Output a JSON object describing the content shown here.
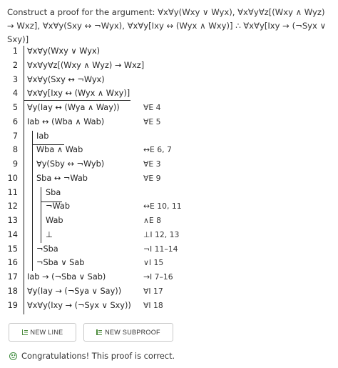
{
  "prompt": "Construct a proof for the argument: ∀x∀y(Wxy ∨ Wyx), ∀x∀y∀z[(Wxy ∧ Wyz) → Wxz], ∀x∀y(Sxy ↔ ¬Wyx), ∀x∀y[Ixy ↔ (Wyx ∧ Wxy)] ∴ ∀x∀y[Ixy → (¬Syx ∨ Sxy)]",
  "lines": [
    {
      "num": "1",
      "formula": "∀x∀y(Wxy ∨ Wyx)",
      "just": "",
      "depth": 0
    },
    {
      "num": "2",
      "formula": "∀x∀y∀z[(Wxy ∧ Wyz) → Wxz]",
      "just": "",
      "depth": 0
    },
    {
      "num": "3",
      "formula": "∀x∀y(Sxy ↔ ¬Wyx)",
      "just": "",
      "depth": 0
    },
    {
      "num": "4",
      "formula": "∀x∀y[Ixy ↔ (Wyx ∧ Wxy)]",
      "just": "",
      "depth": 0
    },
    {
      "num": "5",
      "formula": "∀y(Iay ↔ (Wya ∧ Way))",
      "just": "∀E 4",
      "depth": 0
    },
    {
      "num": "6",
      "formula": "Iab ↔ (Wba ∧ Wab)",
      "just": "∀E 5",
      "depth": 0
    },
    {
      "num": "7",
      "formula": "Iab",
      "just": "",
      "depth": 1
    },
    {
      "num": "8",
      "formula": "Wba ∧ Wab",
      "just": "↔E 6, 7",
      "depth": 1
    },
    {
      "num": "9",
      "formula": "∀y(Sby ↔ ¬Wyb)",
      "just": "∀E 3",
      "depth": 1
    },
    {
      "num": "10",
      "formula": "Sba ↔ ¬Wab",
      "just": "∀E 9",
      "depth": 1
    },
    {
      "num": "11",
      "formula": "Sba",
      "just": "",
      "depth": 2
    },
    {
      "num": "12",
      "formula": "¬Wab",
      "just": "↔E 10, 11",
      "depth": 2
    },
    {
      "num": "13",
      "formula": "Wab",
      "just": "∧E 8",
      "depth": 2
    },
    {
      "num": "14",
      "formula": "⊥",
      "just": "⊥I 12, 13",
      "depth": 2
    },
    {
      "num": "15",
      "formula": "¬Sba",
      "just": "¬I 11–14",
      "depth": 1
    },
    {
      "num": "16",
      "formula": "¬Sba ∨ Sab",
      "just": "∨I 15",
      "depth": 1
    },
    {
      "num": "17",
      "formula": "Iab → (¬Sba ∨ Sab)",
      "just": "→I 7–16",
      "depth": 0
    },
    {
      "num": "18",
      "formula": "∀y(Iay → (¬Sya ∨ Say))",
      "just": "∀I 17",
      "depth": 0
    },
    {
      "num": "19",
      "formula": "∀x∀y(Ixy → (¬Syx ∨ Sxy))",
      "just": "∀I 18",
      "depth": 0
    }
  ],
  "buttons": {
    "new_line": "NEW LINE",
    "new_subproof": "NEW SUBPROOF"
  },
  "status": {
    "message": "Congratulations! This proof is correct.",
    "color": "#3d8c3d"
  }
}
